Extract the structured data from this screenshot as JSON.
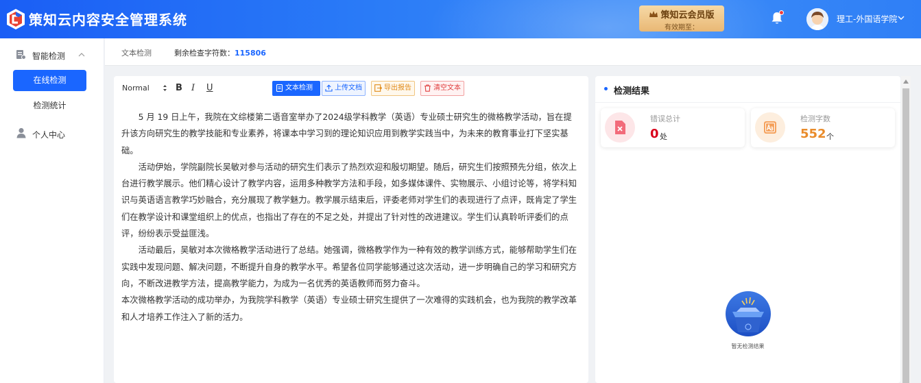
{
  "app": {
    "title": "策知云内容安全管理系统"
  },
  "header": {
    "vip_title": "策知云会员版",
    "vip_sub": "有效期至：",
    "user_name": "理工-外国语学院"
  },
  "sidebar": {
    "group_label": "智能检测",
    "items": [
      {
        "label": "在线检测",
        "active": true
      },
      {
        "label": "检测统计",
        "active": false
      }
    ],
    "user_center": "个人中心"
  },
  "subbar": {
    "breadcrumb": "文本检测",
    "remain_label": "剩余检查字符数：",
    "remain_value": "115806"
  },
  "toolbar": {
    "format": "Normal",
    "bold": "B",
    "italic": "I",
    "underline": "U",
    "check_label": "文本检测",
    "upload_label": "上传文档",
    "export_label": "导出报告",
    "clear_label": "清空文本"
  },
  "document": {
    "paragraphs": [
      "5 月 19 日上午，我院在文综楼第二语音室举办了2024级学科教学（英语）专业硕士研究生的微格教学活动，旨在提升该方向研究生的教学技能和专业素养，将课本中学习到的理论知识应用到教学实践当中，为未来的教育事业打下坚实基础。",
      "活动伊始，学院副院长吴敏对参与活动的研究生们表示了热烈欢迎和殷切期望。随后，研究生们按照预先分组，依次上台进行教学展示。他们精心设计了教学内容，运用多种教学方法和手段，如多媒体课件、实物展示、小组讨论等，将学科知识与英语语言教学巧妙融合，充分展现了教学魅力。教学展示结束后，评委老师对学生们的表现进行了点评，既肯定了学生们在教学设计和课堂组织上的优点，也指出了存在的不足之处，并提出了针对性的改进建议。学生们认真聆听评委们的点评，纷纷表示受益匪浅。",
      "活动最后，吴敏对本次微格教学活动进行了总结。她强调，微格教学作为一种有效的教学训练方式，能够帮助学生们在实践中发现问题、解决问题，不断提升自身的教学水平。希望各位同学能够通过这次活动，进一步明确自己的学习和研究方向，不断改进教学方法，提高教学能力，为成为一名优秀的英语教师而努力奋斗。",
      "本次微格教学活动的成功举办，为我院学科教学（英语）专业硕士研究生提供了一次难得的实践机会，也为我院的教学改革和人才培养工作注入了新的活力。"
    ]
  },
  "result": {
    "title": "检测结果",
    "error_label": "错误总计",
    "error_value": "0",
    "error_unit": "处",
    "count_label": "检测字数",
    "count_value": "552",
    "count_unit": "个",
    "empty_text": "暂无检测结果"
  },
  "colors": {
    "primary": "#1a66ff",
    "error": "#d9001b",
    "count": "#e98b2a"
  }
}
